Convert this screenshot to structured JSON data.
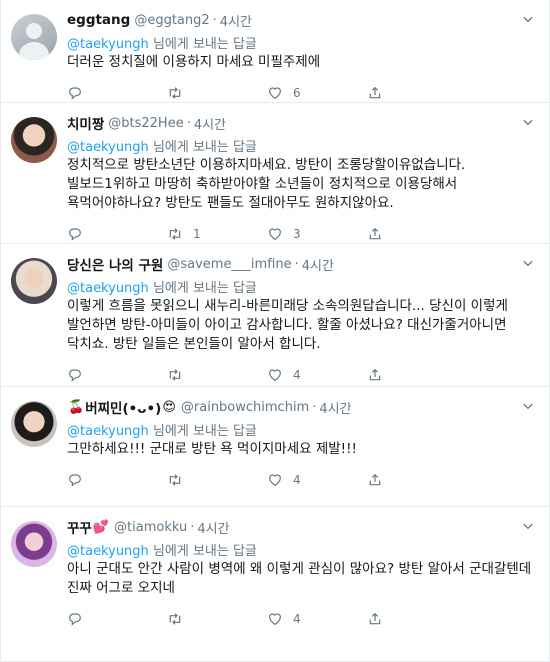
{
  "tweets": [
    {
      "name": "eggtang",
      "handle": "@eggtang2",
      "time": "4시간",
      "mention": "@taekyungh",
      "reply_suffix": "님에게 보내는 답글",
      "text": "더러운 정치질에 이용하지 마세요 미필주제에",
      "replies": "",
      "retweets": "",
      "likes": "6"
    },
    {
      "name": "치미짱",
      "handle": "@bts22Hee",
      "time": "4시간",
      "mention": "@taekyungh",
      "reply_suffix": "님에게 보내는 답글",
      "text": "정치적으로 방탄소년단 이용하지마세요. 방탄이 조롱당할이유없습니다. 빌보드1위하고 마땅히 축하받아야할 소년들이 정치적으로 이용당해서 욕먹어야하나요? 방탄도 팬들도 절대아무도 원하지않아요.",
      "replies": "",
      "retweets": "1",
      "likes": "3"
    },
    {
      "name": "당신은 나의 구원",
      "handle": "@saveme___imfine",
      "time": "4시간",
      "mention": "@taekyungh",
      "reply_suffix": "님에게 보내는 답글",
      "text": "이렇게 흐름을 못읽으니 새누리-바른미래당 소속의원답습니다... 당신이 이렇게 발언하면 방탄-아미들이 아이고 감사합니다. 할줄 아셨나요? 대신가줄거아니면 닥치쇼. 방탄 일들은 본인들이 알아서 합니다.",
      "replies": "",
      "retweets": "",
      "likes": "4"
    },
    {
      "name_prefix_emoji": "🍒",
      "name": "버찌민(•ᴗ•)",
      "name_suffix_emoji": "😍",
      "handle": "@rainbowchimchim",
      "time": "4시간",
      "mention": "@taekyungh",
      "reply_suffix": "님에게 보내는 답글",
      "text": "그만하세요!!! 군대로 방탄 욕 먹이지마세요 제발!!!",
      "replies": "",
      "retweets": "",
      "likes": "4"
    },
    {
      "name": "꾸꾸",
      "name_suffix_emoji": "💕",
      "handle": "@tiamokku",
      "time": "4시간",
      "mention": "@taekyungh",
      "reply_suffix": "님에게 보내는 답글",
      "text": "아니 군대도 안간 사람이 병역에  왜 이렇게 관심이 많아요? 방탄 알아서 군대갈텐데 진짜 어그로 오지네",
      "replies": "",
      "retweets": "",
      "likes": "4"
    }
  ],
  "icons": {
    "reply": "reply-icon",
    "retweet": "retweet-icon",
    "like": "heart-icon",
    "share": "share-icon",
    "more": "chevron-down-icon"
  },
  "colors": {
    "link": "#1da1f2",
    "muted": "#657786",
    "text": "#14171a",
    "divider": "#e6ecf0"
  }
}
